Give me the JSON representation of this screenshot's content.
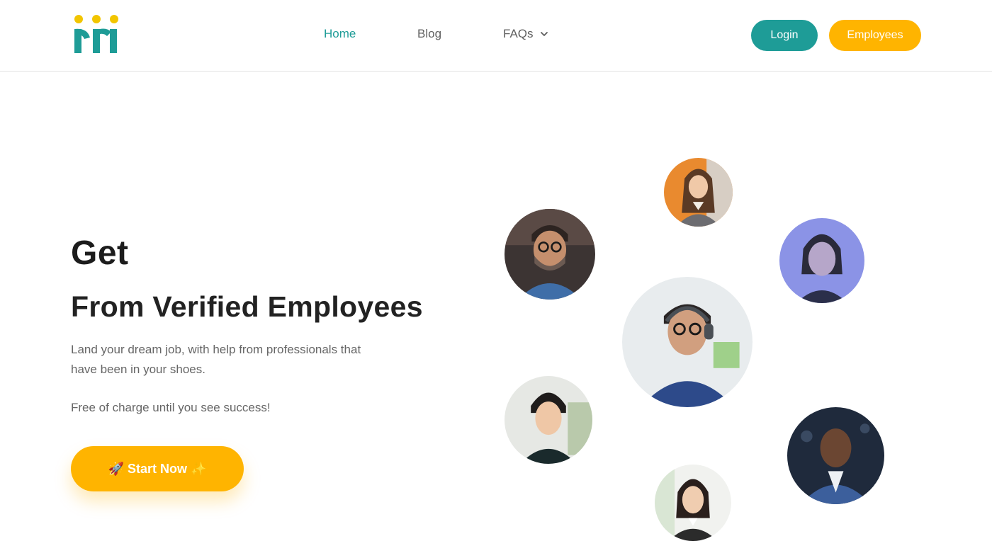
{
  "header": {
    "logo_name": "logo",
    "nav": {
      "home": "Home",
      "blog": "Blog",
      "faqs": "FAQs"
    },
    "login_label": "Login",
    "employees_label": "Employees"
  },
  "hero": {
    "title": "Get",
    "subtitle": "From Verified Employees",
    "description": "Land your dream job, with help from professionals that have been in your shoes.",
    "note": "Free of charge until you see success!",
    "cta_label": "🚀 Start Now ✨"
  },
  "colors": {
    "accent_teal": "#1e9c97",
    "accent_yellow": "#ffb400",
    "logo_dot": "#f2c500"
  },
  "avatars": [
    {
      "name": "avatar-woman-orange-background"
    },
    {
      "name": "avatar-man-glasses-beard"
    },
    {
      "name": "avatar-woman-blue-light"
    },
    {
      "name": "avatar-man-headphones"
    },
    {
      "name": "avatar-woman-dark-turtleneck"
    },
    {
      "name": "avatar-man-suit"
    },
    {
      "name": "avatar-woman-office"
    }
  ]
}
